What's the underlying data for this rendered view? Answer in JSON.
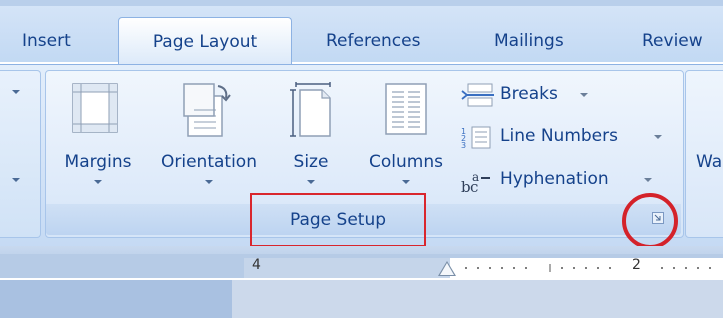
{
  "tabs": {
    "insert": "Insert",
    "page_layout": "Page Layout",
    "references": "References",
    "mailings": "Mailings",
    "review": "Review"
  },
  "group": {
    "label": "Page Setup",
    "buttons": {
      "margins": "Margins",
      "orientation": "Orientation",
      "size": "Size",
      "columns": "Columns",
      "breaks": "Breaks",
      "line_numbers": "Line Numbers",
      "hyphenation": "Hyphenation"
    }
  },
  "next_group_partial_label": "Wa",
  "ruler": {
    "label_left": "4",
    "label_right": "2"
  },
  "colors": {
    "ribbon_text": "#15428b",
    "highlight_red": "#d9262d",
    "ribbon_bg": "#d3e3f7"
  },
  "icons": {
    "margins": "margins-icon",
    "orientation": "orientation-icon",
    "size": "size-icon",
    "columns": "columns-icon",
    "breaks": "breaks-icon",
    "line_numbers": "line-numbers-icon",
    "hyphenation": "hyphenation-icon",
    "dialog_launcher": "dialog-launcher-icon"
  }
}
